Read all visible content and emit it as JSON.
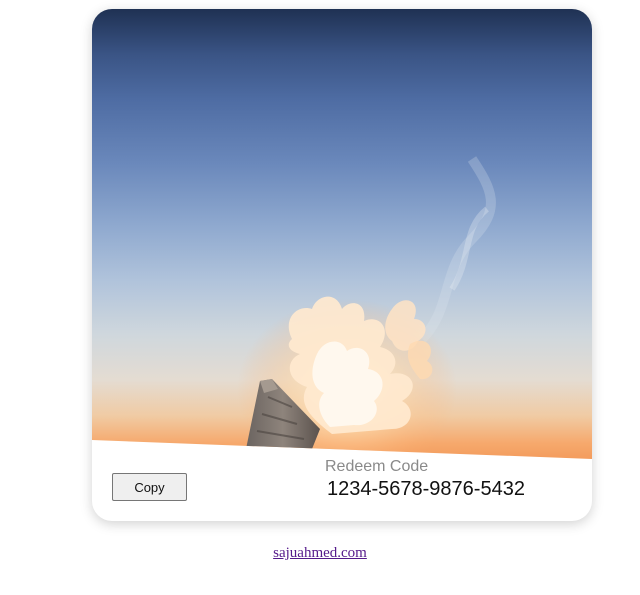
{
  "card": {
    "image_alt": "torch flame against sunset sky",
    "redeem_label": "Redeem Code",
    "redeem_code": "1234-5678-9876-5432",
    "copy_button_label": "Copy"
  },
  "footer": {
    "link_text": "sajuahmed.com"
  },
  "colors": {
    "link_visited": "#551a8b",
    "sky_top": "#1f3153",
    "sky_horizon": "#f39a5b"
  }
}
